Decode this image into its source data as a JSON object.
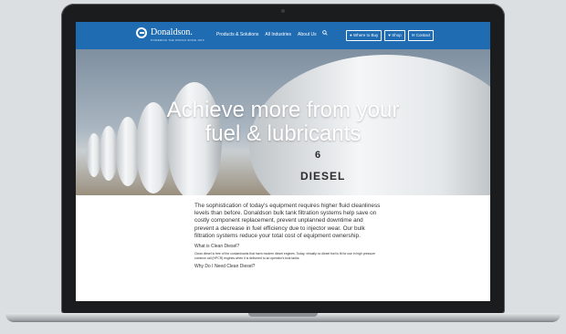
{
  "nav": {
    "logo_text": "Donaldson.",
    "logo_subtext": "POWERING THE WORLD SINCE 1915",
    "links": [
      "Products & Solutions",
      "All Industries",
      "About Us"
    ],
    "buttons": [
      "Where to Buy",
      "Shop",
      "Contact"
    ]
  },
  "hero": {
    "title_line1": "Achieve more from your",
    "title_line2": "fuel & lubricants",
    "tank_number": "6",
    "tank_label": "DIESEL"
  },
  "content": {
    "intro": "The sophistication of today's equipment requires higher fluid cleanliness levels than before. Donaldson bulk tank filtration systems help save on costly component replacement, prevent unplanned downtime and prevent a decrease in fuel efficiency due to injector wear. Our bulk filtration systems reduce your total cost of equipment ownership.",
    "heading1": "What is Clean Diesel?",
    "paragraph1": "Clean diesel is free of the contaminants that harm modern diesel engines. Today, virtually no diesel fuel is fit for use in high pressure common rail (HPCR) engines when it is delivered to an operator's bulk tanks.",
    "heading2": "Why Do I Need Clean Diesel?"
  },
  "colors": {
    "nav_blue": "#1f6cb3",
    "bezel": "#1b1c1e",
    "page_background": "#dcdfe1"
  },
  "icons": {
    "search": "magnifier-icon",
    "where_to_buy": "location-pin-icon",
    "shop": "heart-icon",
    "contact": "envelope-icon"
  }
}
